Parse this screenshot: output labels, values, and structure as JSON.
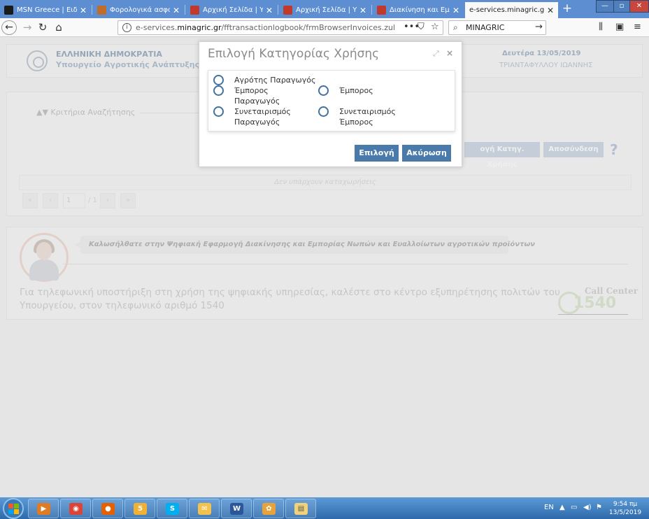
{
  "browser": {
    "tabs": [
      {
        "title": "MSN Greece | Ειδήσεις",
        "icon_color": "#1b1b1b",
        "icon": "msn-icon",
        "active": false
      },
      {
        "title": "Φορολογικά ασφαλιστ",
        "icon_color": "#c06d2b",
        "icon": "site-icon",
        "active": false
      },
      {
        "title": "Αρχική Σελίδα | Υπουργ",
        "icon_color": "#c0392b",
        "icon": "site-icon",
        "active": false
      },
      {
        "title": "Αρχική Σελίδα | Υπουργ",
        "icon_color": "#c0392b",
        "icon": "site-icon",
        "active": false
      },
      {
        "title": "Διακίνηση και Εμπορία",
        "icon_color": "#c0392b",
        "icon": "site-icon",
        "active": false
      },
      {
        "title": "e-services.minagric.gr/fftra",
        "icon_color": "#f9f9fa",
        "icon": "",
        "active": true
      }
    ],
    "new_tab": "+",
    "window_controls": {
      "minimize": "—",
      "restore": "▫",
      "close": "✕"
    },
    "url_prefix": "e-services.",
    "url_domain": "minagric.gr",
    "url_path": "/fftransactionlogbook/frmBrowserInvoices.zul",
    "search_text": "MINAGRIC"
  },
  "header": {
    "line1": "ΕΛΛΗΝΙΚΗ ΔΗΜΟΚΡΑΤΙΑ",
    "line2": "Υπουργείο Αγροτικής Ανάπτυξης και Τ",
    "date": "Δευτέρα 13/05/2019",
    "user": "ΤΡΙΑΝΤΑΦΥΛΛΟΥ ΙΩΑΝΝΗΣ"
  },
  "search": {
    "criteria_label": "▲▼ Κριτήρια Αναζήτησης",
    "category_button": "ογή Κατηγ. Χρήσης",
    "logout_button": "Αποσύνδεση",
    "help": "?",
    "no_entries": "Δεν υπάρχουν καταχωρήσεις",
    "pager": {
      "first": "«",
      "prev": "‹",
      "page": "1",
      "total": "/ 1",
      "next": "›",
      "last": "»"
    }
  },
  "welcome": {
    "message": "Καλωσήλθατε στην Ψηφιακή Εφαρμογή Διακίνησης και Εμπορίας Νωπών και Ευαλλοίωτων αγροτικών προϊόντων",
    "support": "Για τηλεφωνική υποστήριξη στη χρήση της ψηφιακής υπηρεσίας, καλέστε στο κέντρο εξυπηρέτησης πολιτών του Υπουργείου, στον τηλεφωνικό αριθμό 1540",
    "call_center_label": "Call Center",
    "call_center_number": "1540"
  },
  "dialog": {
    "title": "Επιλογή Κατηγορίας Χρήσης",
    "expand": "⤢",
    "close": "×",
    "options": [
      {
        "label_1": "Αγρότης Παραγωγός",
        "label_2": ""
      },
      {
        "label_1": "Έμπορος",
        "label_2": "Παραγωγός"
      },
      {
        "label_1": "Συνεταιρισμός",
        "label_2": "Παραγωγός"
      },
      {
        "label_1": "Έμπορος",
        "label_2": ""
      },
      {
        "label_1": "Συνεταιρισμός",
        "label_2": "Έμπορος"
      }
    ],
    "select_button": "Επιλογή",
    "cancel_button": "Ακύρωση"
  },
  "taskbar": {
    "items": [
      {
        "name": "media-player",
        "color": "#e07b22",
        "glyph": "▶"
      },
      {
        "name": "chrome",
        "color": "#db4437",
        "glyph": "◉"
      },
      {
        "name": "firefox",
        "color": "#e66000",
        "glyph": "●"
      },
      {
        "name": "app-5",
        "color": "#f2b134",
        "glyph": "5"
      },
      {
        "name": "skype",
        "color": "#00aff0",
        "glyph": "S"
      },
      {
        "name": "mail",
        "color": "#f2c14e",
        "glyph": "✉"
      },
      {
        "name": "word",
        "color": "#2b579a",
        "glyph": "W"
      },
      {
        "name": "app-grid",
        "color": "#e8a23a",
        "glyph": "✿"
      },
      {
        "name": "explorer",
        "color": "#f1d27a",
        "glyph": "▤"
      }
    ],
    "language": "EN",
    "time": "9:54 πμ",
    "date": "13/5/2019"
  }
}
